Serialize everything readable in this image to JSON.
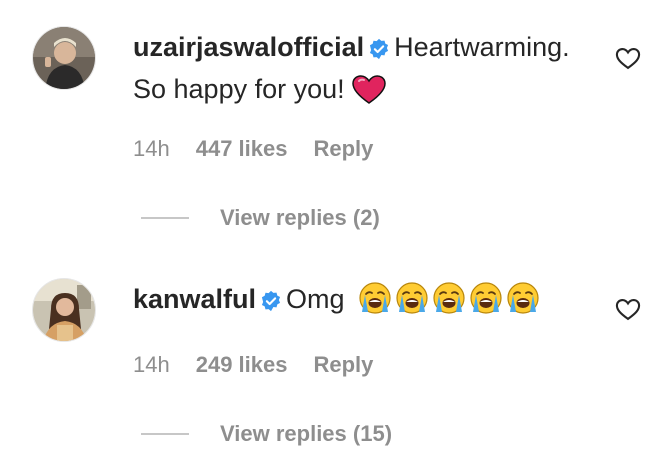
{
  "comments": [
    {
      "username": "uzairjaswalofficial",
      "verified_icon": "verified-badge-icon",
      "text_line1": "Heartwarming.",
      "text_line2": "So happy for you!",
      "emoji": "red-heart-emoji",
      "time": "14h",
      "likes": "447 likes",
      "reply_label": "Reply",
      "view_replies": "View replies (2)",
      "like_icon": "heart-outline-icon"
    },
    {
      "username": "kanwalful",
      "verified_icon": "verified-badge-icon",
      "text_line1": "Omg",
      "emoji": "loudly-crying-face-emoji",
      "emoji_count": 5,
      "time": "14h",
      "likes": "249 likes",
      "reply_label": "Reply",
      "view_replies": "View replies (15)",
      "like_icon": "heart-outline-icon"
    }
  ],
  "colors": {
    "text": "#262626",
    "muted": "#8e8e8e",
    "verified": "#3897f0",
    "heart_emoji": "#e0245e"
  }
}
